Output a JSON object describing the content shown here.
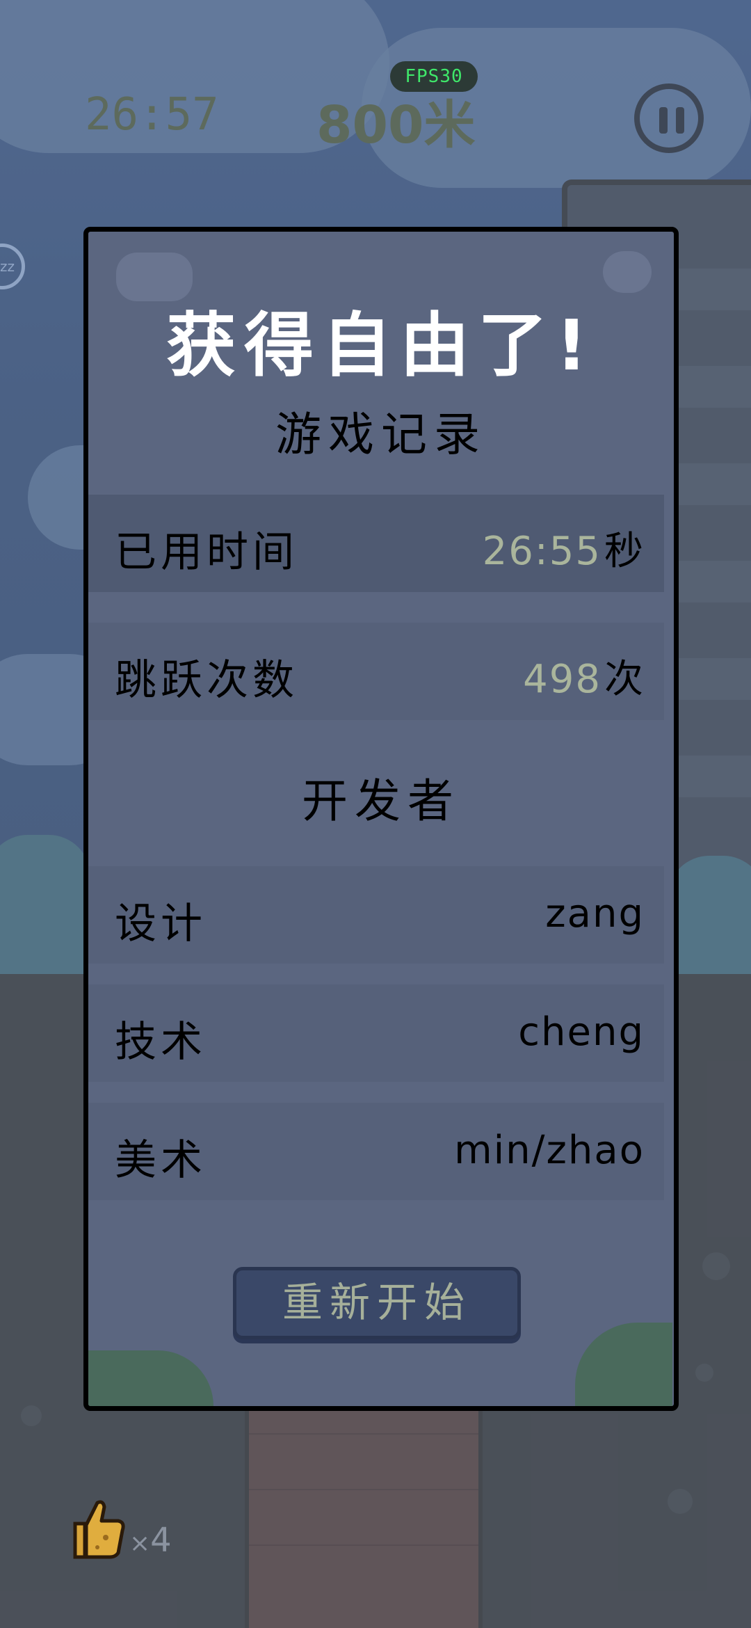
{
  "hud": {
    "fps": "FPS30",
    "timer": "26:57",
    "distance": "800米",
    "like_count": "4",
    "like_prefix": "×"
  },
  "dialog": {
    "title": "获得自由了!",
    "record_heading": "游戏记录",
    "rows": [
      {
        "label": "已用时间",
        "value": "26:55",
        "unit": "秒"
      },
      {
        "label": "跳跃次数",
        "value": "498",
        "unit": "次"
      }
    ],
    "developers_heading": "开发者",
    "developers": [
      {
        "label": "设计",
        "value": "zang"
      },
      {
        "label": "技术",
        "value": "cheng"
      },
      {
        "label": "美术",
        "value": "min/zhao"
      }
    ],
    "restart_label": "重新开始"
  },
  "colors": {
    "dialog_bg": "#5b6680",
    "row_bg": "#56617a",
    "accent_number": "#aab59c",
    "fps_text": "#3fe86a",
    "button_bg": "#3a4868"
  },
  "icons": [
    "pause-icon",
    "sleep-icon",
    "thumbs-up-icon"
  ]
}
